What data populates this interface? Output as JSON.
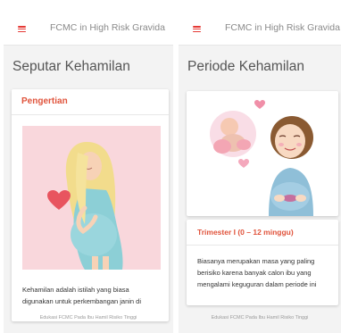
{
  "left": {
    "appbar": {
      "title": "FCMC in High Risk Gravida"
    },
    "section_title": "Seputar Kehamilan",
    "card": {
      "header": "Pengertian",
      "text_line1": "Kehamilan adalah istilah yang biasa",
      "text_line2": "digunakan untuk perkembangan janin di"
    },
    "footer": "Edukasi FCMC Pada Ibu Hamil Risiko Tinggi"
  },
  "right": {
    "appbar": {
      "title": "FCMC in High Risk Gravida"
    },
    "section_title": "Periode Kehamilan",
    "card": {
      "header": "Trimester I (0 – 12 minggu)",
      "text_line1": "Biasanya merupakan masa yang paling",
      "text_line2": "berisiko karena banyak calon ibu yang",
      "text_line3": "mengalami keguguran dalam periode ini"
    },
    "footer": "Edukasi FCMC Pada Ibu Hamil Risiko Tinggi"
  },
  "colors": {
    "accent": "#e0533b",
    "menu_icon": "#e53935",
    "illustration_bg": "#f9d7dc",
    "dress": "#8ccfd6",
    "hair": "#f2dc8c"
  },
  "icons": [
    "menu-icon",
    "heart-icon"
  ]
}
